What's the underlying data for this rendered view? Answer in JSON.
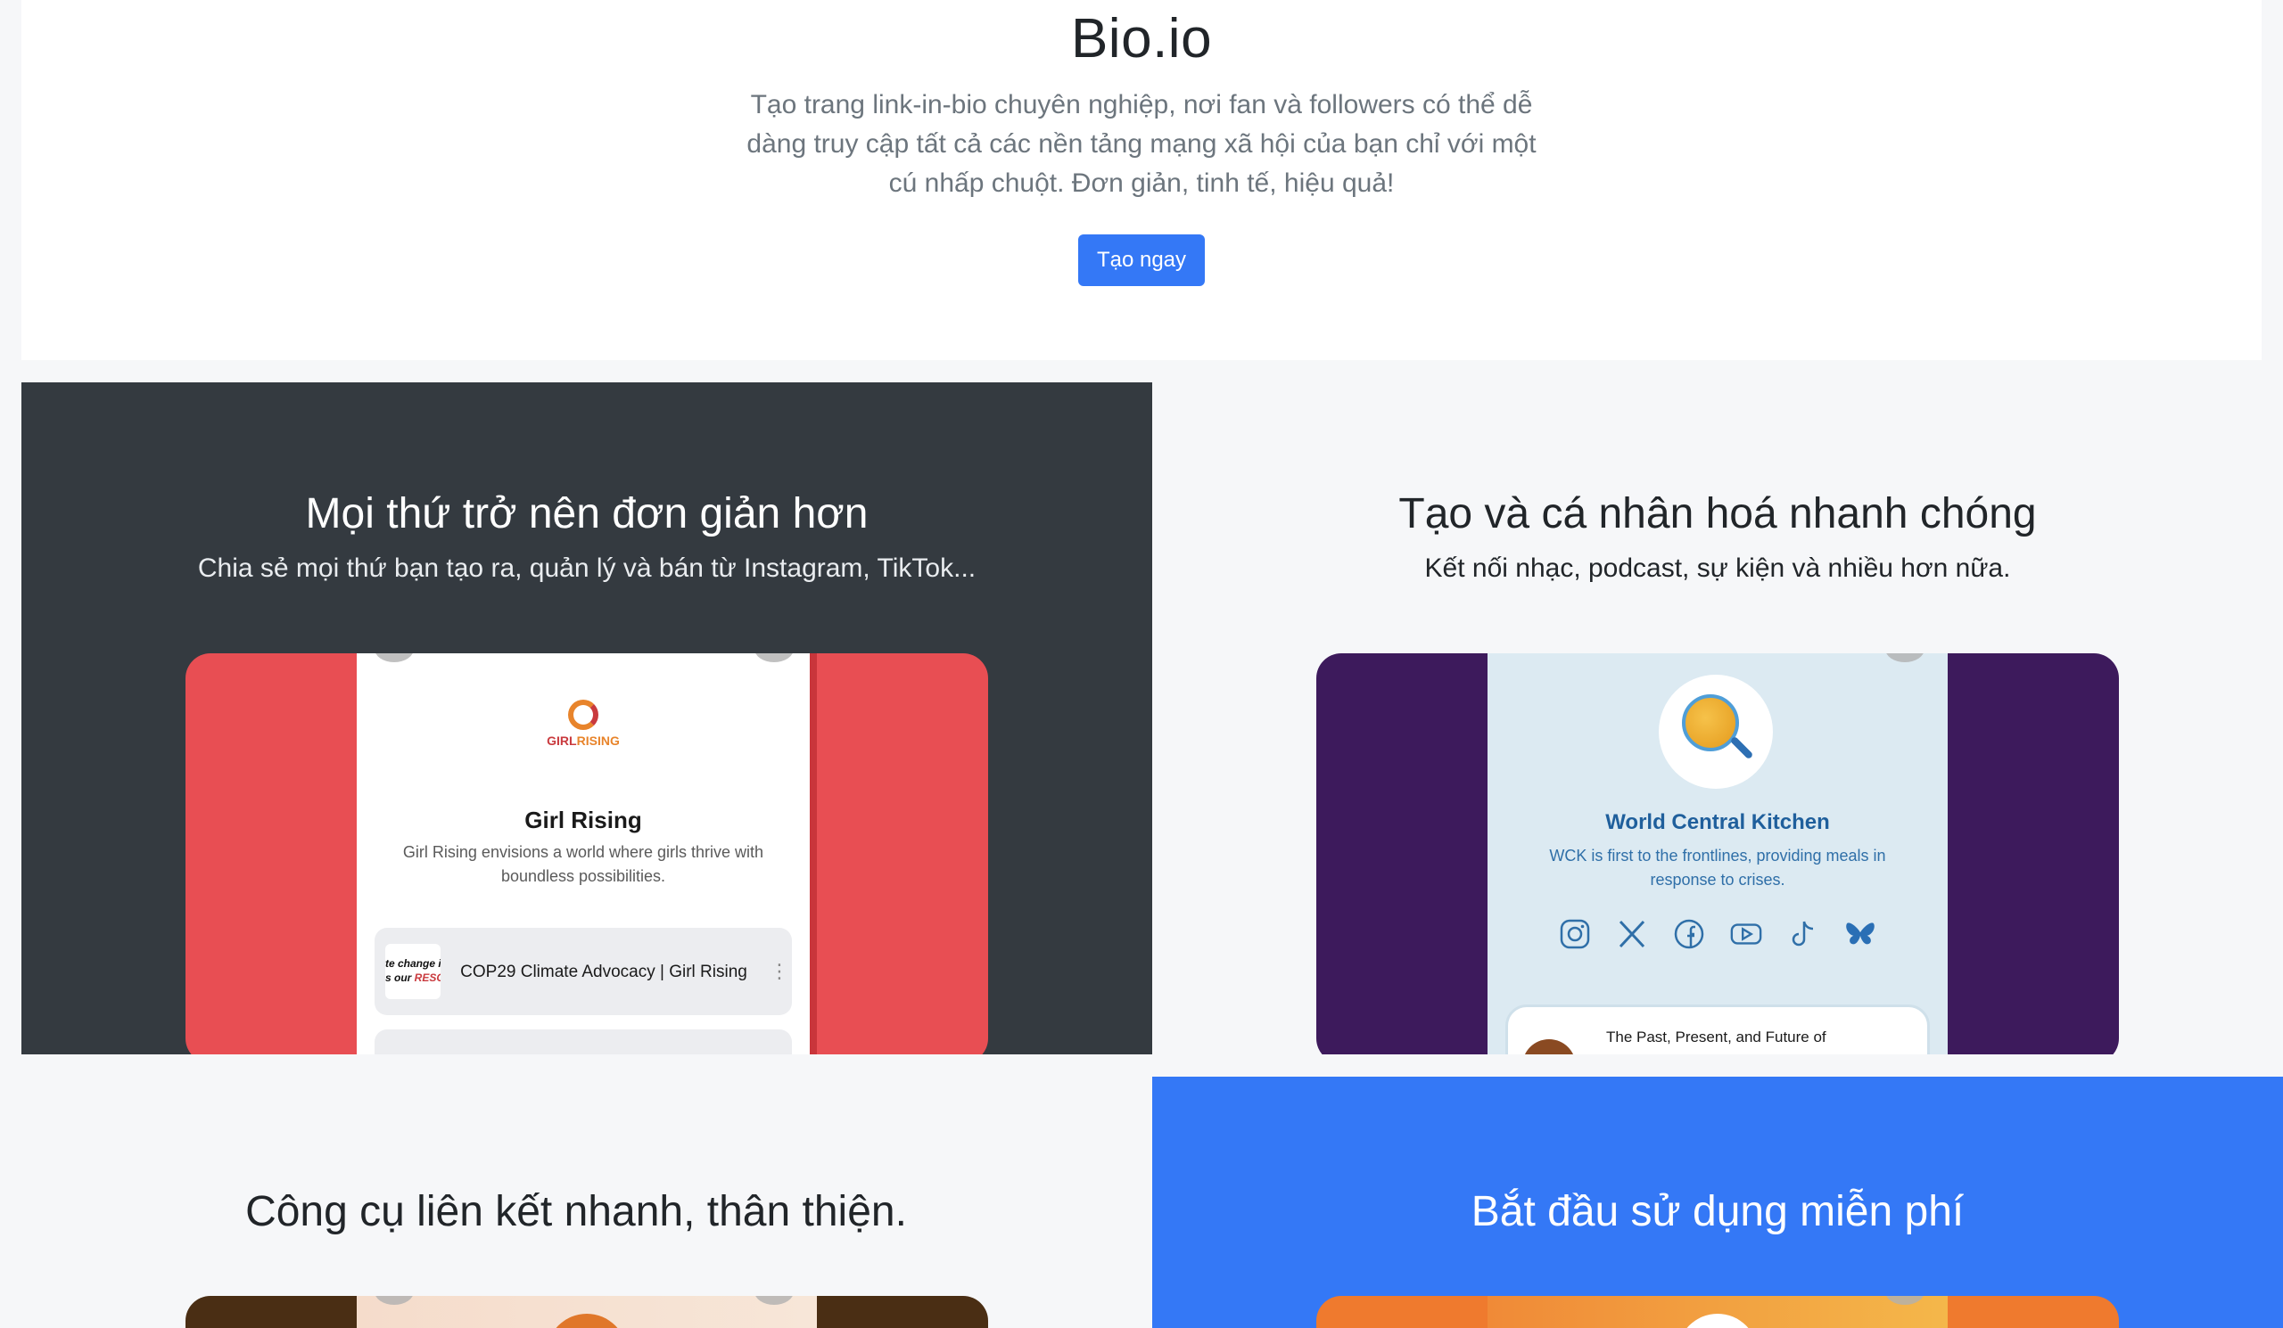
{
  "hero": {
    "title": "Bio.io",
    "description": "Tạo trang link-in-bio chuyên nghiệp, nơi fan và followers có thể dễ dàng truy cập tất cả các nền tảng mạng xã hội của bạn chỉ với một cú nhấp chuột. Đơn giản, tinh tế, hiệu quả!",
    "cta_label": "Tạo ngay",
    "accent_color": "#3478f6"
  },
  "features": [
    {
      "title": "Mọi thứ trở nên đơn giản hơn",
      "subtitle": "Chia sẻ mọi thứ bạn tạo ra, quản lý và bán từ Instagram, TikTok...",
      "background": "#343a40",
      "preview": {
        "logo_text_a": "GIRL",
        "logo_text_b": "RISING",
        "name": "Girl Rising",
        "description": "Girl Rising envisions a world where girls thrive with boundless possibilities.",
        "thumb_line1": "te change i",
        "thumb_line2": "s our ",
        "thumb_line2b": "RESO",
        "link_title": "COP29 Climate Advocacy | Girl Rising",
        "more_icon": "kebab-icon"
      }
    },
    {
      "title": "Tạo và cá nhân hoá nhanh chóng",
      "subtitle": "Kết nối nhạc, podcast, sự kiện và nhiều hơn nữa.",
      "background": "#f6f7f9",
      "preview": {
        "name": "World Central Kitchen",
        "description": "WCK is first to the frontlines, providing meals in response to crises.",
        "socials": [
          "instagram-icon",
          "x-icon",
          "facebook-icon",
          "youtube-icon",
          "tiktok-icon",
          "bluesky-icon"
        ],
        "link_title": "The Past, Present, and Future of"
      }
    },
    {
      "title": "Công cụ liên kết nhanh, thân thiện.",
      "background": "#f6f7f9"
    },
    {
      "title": "Bắt đầu sử dụng miễn phí",
      "background": "#3478f6"
    }
  ]
}
